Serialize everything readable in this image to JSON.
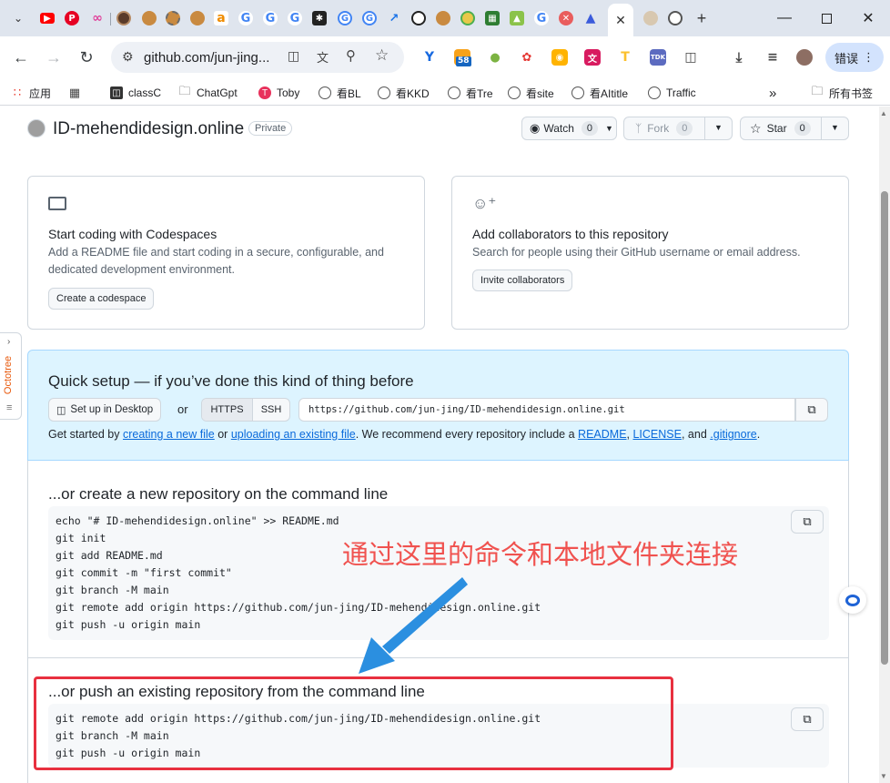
{
  "browser": {
    "tabs": [
      {
        "icon": "tab-search-icon"
      },
      {
        "icon": "youtube-icon"
      },
      {
        "icon": "pinterest-icon"
      },
      {
        "icon": "butterfly-icon"
      },
      {
        "icon": "tab-icon"
      },
      {
        "icon": "tab-icon"
      },
      {
        "icon": "tab-icon"
      },
      {
        "icon": "tab-icon"
      },
      {
        "icon": "amazon-icon"
      },
      {
        "icon": "google-icon"
      },
      {
        "icon": "google-icon"
      },
      {
        "icon": "google-icon"
      },
      {
        "icon": "tab-icon"
      },
      {
        "icon": "translate-icon"
      },
      {
        "icon": "translate-icon"
      },
      {
        "icon": "trend-icon"
      },
      {
        "icon": "tab-icon"
      },
      {
        "icon": "tab-icon"
      },
      {
        "icon": "tab-icon"
      },
      {
        "icon": "tab-icon"
      },
      {
        "icon": "tab-icon"
      },
      {
        "icon": "google-icon"
      },
      {
        "icon": "tab-icon"
      },
      {
        "icon": "tab-icon"
      },
      {
        "icon": "github-tab-icon"
      },
      {
        "icon": "tab-icon"
      },
      {
        "icon": "globe-icon"
      }
    ],
    "new_tab": "+",
    "url": "github.com/jun-jing...",
    "profile_label": "错误",
    "bookmarks": [
      {
        "label": "应用",
        "icon": "apps-icon"
      },
      {
        "label": "",
        "icon": "grid-icon"
      },
      {
        "label": "classC",
        "icon": "bookmark-icon"
      },
      {
        "label": "ChatGpt",
        "icon": "folder-icon"
      },
      {
        "label": "Toby",
        "icon": "toby-icon"
      },
      {
        "label": "看BL",
        "icon": "globe-icon"
      },
      {
        "label": "看KKD",
        "icon": "globe-icon"
      },
      {
        "label": "看Tre",
        "icon": "globe-icon"
      },
      {
        "label": "看site",
        "icon": "globe-icon"
      },
      {
        "label": "看AItitle",
        "icon": "globe-icon"
      },
      {
        "label": "Traffic",
        "icon": "globe-icon"
      }
    ],
    "bookmarks_more": "»",
    "all_bookmarks": "所有书签",
    "extension_badge": "58",
    "tdk_label": "TDK"
  },
  "repo": {
    "name": "ID-mehendidesign.online",
    "visibility": "Private",
    "watch_label": "Watch",
    "watch_count": "0",
    "fork_label": "Fork",
    "fork_count": "0",
    "star_label": "Star",
    "star_count": "0"
  },
  "codespaces": {
    "title": "Start coding with Codespaces",
    "desc": "Add a README file and start coding in a secure, configurable, and dedicated development environment.",
    "button": "Create a codespace"
  },
  "collaborators": {
    "title": "Add collaborators to this repository",
    "desc": "Search for people using their GitHub username or email address.",
    "button": "Invite collaborators"
  },
  "quick_setup": {
    "title": "Quick setup — if you’ve done this kind of thing before",
    "desktop_button": "Set up in Desktop",
    "or": "or",
    "https": "HTTPS",
    "ssh": "SSH",
    "clone_url": "https://github.com/jun-jing/ID-mehendidesign.online.git",
    "hint_1": "Get started by ",
    "link_new_file": "creating a new file",
    "hint_2": " or ",
    "link_upload": "uploading an existing file",
    "hint_3": ". We recommend every repository include a ",
    "link_readme": "README",
    "hint_4": ", ",
    "link_license": "LICENSE",
    "hint_5": ", and ",
    "link_gitignore": ".gitignore",
    "hint_6": "."
  },
  "create_section": {
    "title": "...or create a new repository on the command line",
    "lines": [
      "echo \"# ID-mehendidesign.online\" >> README.md",
      "git init",
      "git add README.md",
      "git commit -m \"first commit\"",
      "git branch -M main",
      "git remote add origin https://github.com/jun-jing/ID-mehendidesign.online.git",
      "git push -u origin main"
    ]
  },
  "push_section": {
    "title": "...or push an existing repository from the command line",
    "lines": [
      "git remote add origin https://github.com/jun-jing/ID-mehendidesign.online.git",
      "git branch -M main",
      "git push -u origin main"
    ]
  },
  "annotation": {
    "text": "通过这里的命令和本地文件夹连接",
    "color": "#f0524f",
    "arrow_color": "#2b8fe0",
    "box_color": "#e8303f"
  },
  "octotree_label": "Octotree"
}
